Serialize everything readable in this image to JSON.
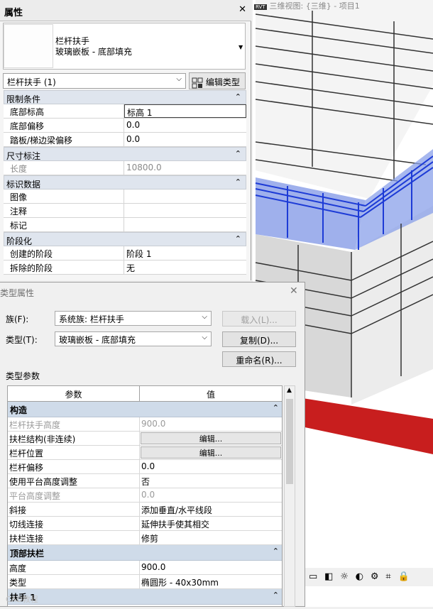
{
  "properties": {
    "title": "属性",
    "type_name_line1": "栏杆扶手",
    "type_name_line2": "玻璃嵌板 - 底部填充",
    "instance_selector": "栏杆扶手 (1)",
    "edit_type_label": "编辑类型",
    "groups": [
      {
        "name": "限制条件",
        "rows": [
          {
            "key": "底部标高",
            "value": "标高 1"
          },
          {
            "key": "底部偏移",
            "value": "0.0"
          },
          {
            "key": "踏板/梯边梁偏移",
            "value": "0.0"
          }
        ]
      },
      {
        "name": "尺寸标注",
        "rows": [
          {
            "key": "长度",
            "value": "10800.0"
          }
        ]
      },
      {
        "name": "标识数据",
        "rows": [
          {
            "key": "图像",
            "value": ""
          },
          {
            "key": "注释",
            "value": ""
          },
          {
            "key": "标记",
            "value": ""
          }
        ]
      },
      {
        "name": "阶段化",
        "rows": [
          {
            "key": "创建的阶段",
            "value": "阶段 1"
          },
          {
            "key": "拆除的阶段",
            "value": "无"
          }
        ]
      }
    ]
  },
  "view": {
    "title": "三维视图: {三维} - 项目1",
    "tag": "RVT"
  },
  "dialog": {
    "title": "类型属性",
    "family_label": "族(F):",
    "family_value": "系统族: 栏杆扶手",
    "type_label": "类型(T):",
    "type_value": "玻璃嵌板 - 底部填充",
    "load_btn": "载入(L)...",
    "dup_btn": "复制(D)...",
    "rename_btn": "重命名(R)...",
    "type_params_label": "类型参数",
    "col_param": "参数",
    "col_value": "值",
    "sections": [
      {
        "name": "构造",
        "rows": [
          {
            "key": "栏杆扶手高度",
            "value": "900.0",
            "disabled": true
          },
          {
            "key": "扶栏结构(非连续)",
            "value": "编辑...",
            "button": true
          },
          {
            "key": "栏杆位置",
            "value": "编辑...",
            "button": true
          },
          {
            "key": "栏杆偏移",
            "value": "0.0"
          },
          {
            "key": "使用平台高度调整",
            "value": "否"
          },
          {
            "key": "平台高度调整",
            "value": "0.0",
            "disabled": true
          },
          {
            "key": "斜接",
            "value": "添加垂直/水平线段"
          },
          {
            "key": "切线连接",
            "value": "延伸扶手使其相交"
          },
          {
            "key": "扶栏连接",
            "value": "修剪"
          }
        ]
      },
      {
        "name": "顶部扶栏",
        "rows": [
          {
            "key": "高度",
            "value": "900.0"
          },
          {
            "key": "类型",
            "value": "椭圆形 - 40x30mm"
          }
        ]
      },
      {
        "name": "扶手 1",
        "rows": []
      }
    ]
  },
  "colors": {
    "selection_blue": "#3b5bd8",
    "floor_red": "#c81e1e",
    "group_bg": "#dfe5ee"
  },
  "watermark": "CAD教程"
}
